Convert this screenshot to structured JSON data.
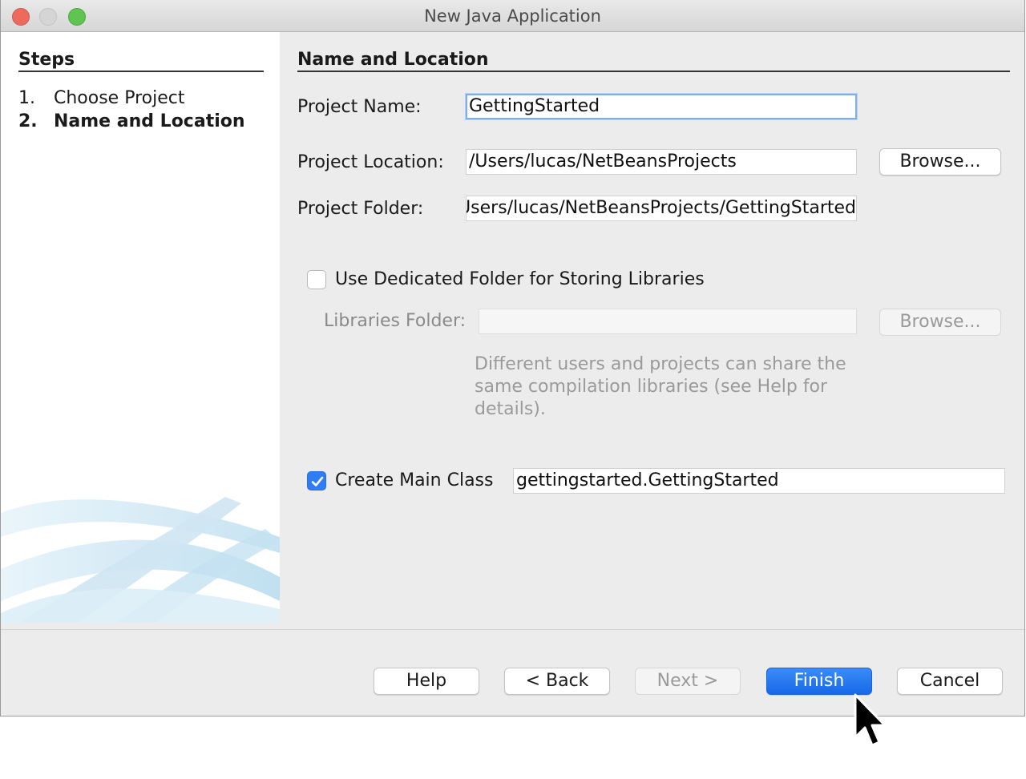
{
  "window": {
    "title": "New Java Application"
  },
  "steps": {
    "heading": "Steps",
    "items": [
      {
        "num": "1.",
        "label": "Choose Project",
        "current": false
      },
      {
        "num": "2.",
        "label": "Name and Location",
        "current": true
      }
    ]
  },
  "form": {
    "heading": "Name and Location",
    "project_name": {
      "label": "Project Name:",
      "value": "GettingStarted"
    },
    "project_location": {
      "label": "Project Location:",
      "value": "/Users/lucas/NetBeansProjects",
      "browse_label": "Browse..."
    },
    "project_folder": {
      "label": "Project Folder:",
      "value": "/Users/lucas/NetBeansProjects/GettingStarted"
    },
    "dedicated_folder": {
      "label": "Use Dedicated Folder for Storing Libraries",
      "checked": false
    },
    "libraries_folder": {
      "label": "Libraries Folder:",
      "value": "",
      "browse_label": "Browse..."
    },
    "hint_lines": [
      "Different users and projects can share the",
      "same compilation libraries (see Help for",
      "details)."
    ],
    "main_class": {
      "label": "Create Main Class",
      "checked": true,
      "value": "gettingstarted.GettingStarted"
    }
  },
  "buttons": {
    "help": "Help",
    "back": "< Back",
    "next": "Next >",
    "finish": "Finish",
    "cancel": "Cancel"
  },
  "colors": {
    "primary_button": "#1768e8",
    "checkbox_checked": "#2e7cf6",
    "focus_ring": "#7eaef0"
  }
}
